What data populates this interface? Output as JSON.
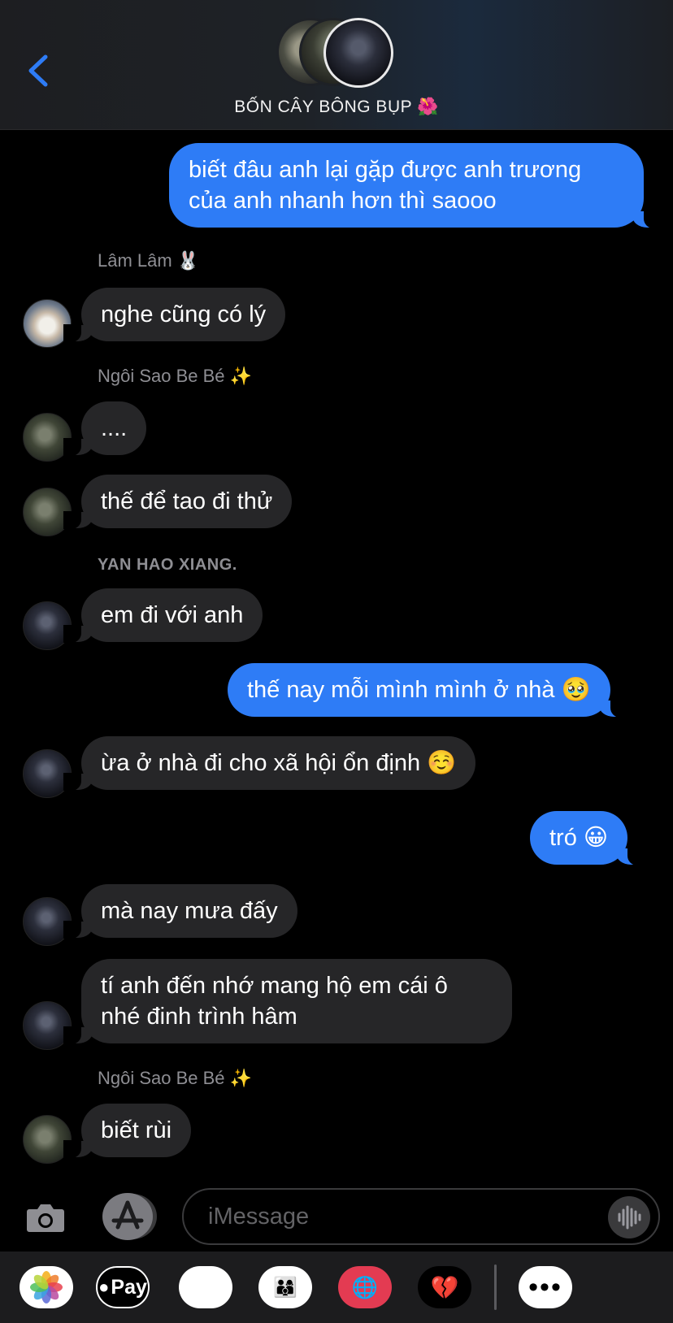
{
  "header": {
    "back_icon": "chevron-left-icon",
    "group_name": "BỐN CÂY BÔNG BỤP 🌺",
    "accent_color": "#2e7cf6"
  },
  "messages": [
    {
      "from": "me",
      "text_lines": [
        "biết đâu anh lại gặp được anh trương",
        "của anh nhanh hơn thì saooo"
      ]
    },
    {
      "from": "Lâm Lâm 🐰",
      "sender_label": "Lâm Lâm 🐰",
      "text": "nghe cũng có lý"
    },
    {
      "from": "Ngôi Sao Be Bé ✨",
      "sender_label": "Ngôi Sao Be Bé ✨",
      "text": "...."
    },
    {
      "from": "Ngôi Sao Be Bé ✨",
      "text": "thế để tao đi thử"
    },
    {
      "from": "YAN HAO XIANG.",
      "sender_label": "YAN HAO XIANG.",
      "text": "em đi với anh"
    },
    {
      "from": "me",
      "text": "thế nay mỗi mình mình ở nhà 🥹"
    },
    {
      "from": "YAN HAO XIANG.",
      "text": "ừa ở nhà đi cho xã hội ổn định ☺️"
    },
    {
      "from": "me",
      "text": "tró 😀"
    },
    {
      "from": "YAN HAO XIANG.",
      "text": "mà nay mưa đấy"
    },
    {
      "from": "YAN HAO XIANG.",
      "text_lines": [
        "tí anh đến nhớ mang hộ em cái ô",
        "nhé đinh trình hâm"
      ]
    },
    {
      "from": "Ngôi Sao Be Bé ✨",
      "sender_label": "Ngôi Sao Be Bé ✨",
      "text": "biết rùi"
    }
  ],
  "input": {
    "placeholder": "iMessage",
    "camera_icon": "camera-icon",
    "apps_icon": "app-store-icon",
    "voice_icon": "waveform-icon"
  },
  "app_strip": {
    "photos_icon": "photos-icon",
    "apple_pay_label": "Pay",
    "memoji_glyph": "🐵",
    "stickers_glyph": "👨‍👩‍👦",
    "search_glyph": "🌐",
    "heart_glyph": "💔",
    "more_label": "•••"
  }
}
